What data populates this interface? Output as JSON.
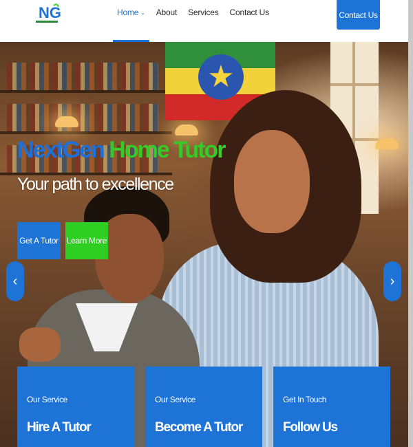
{
  "header": {
    "logo_text": "NG",
    "nav": [
      {
        "label": "Home",
        "active": true,
        "has_dropdown": true
      },
      {
        "label": "About",
        "active": false
      },
      {
        "label": "Services",
        "active": false
      },
      {
        "label": "Contact Us",
        "active": false
      }
    ],
    "dropdown_glyph": "⌄",
    "contact_button": "Contact Us"
  },
  "hero": {
    "title_part1": "NextGen",
    "title_part2": "Home Tutor",
    "subtitle": "Your path to excellence",
    "primary_button": "Get A Tutor",
    "secondary_button": "Learn More",
    "prev_arrow": "‹",
    "next_arrow": "›"
  },
  "cards": [
    {
      "eyebrow": "Our Service",
      "title": "Hire A Tutor"
    },
    {
      "eyebrow": "Our Service",
      "title": "Become A Tutor"
    },
    {
      "eyebrow": "Get In Touch",
      "title": "Follow Us"
    }
  ],
  "colors": {
    "primary_blue": "#1e73d6",
    "accent_green": "#37c928",
    "button_green": "#2ecf22"
  }
}
